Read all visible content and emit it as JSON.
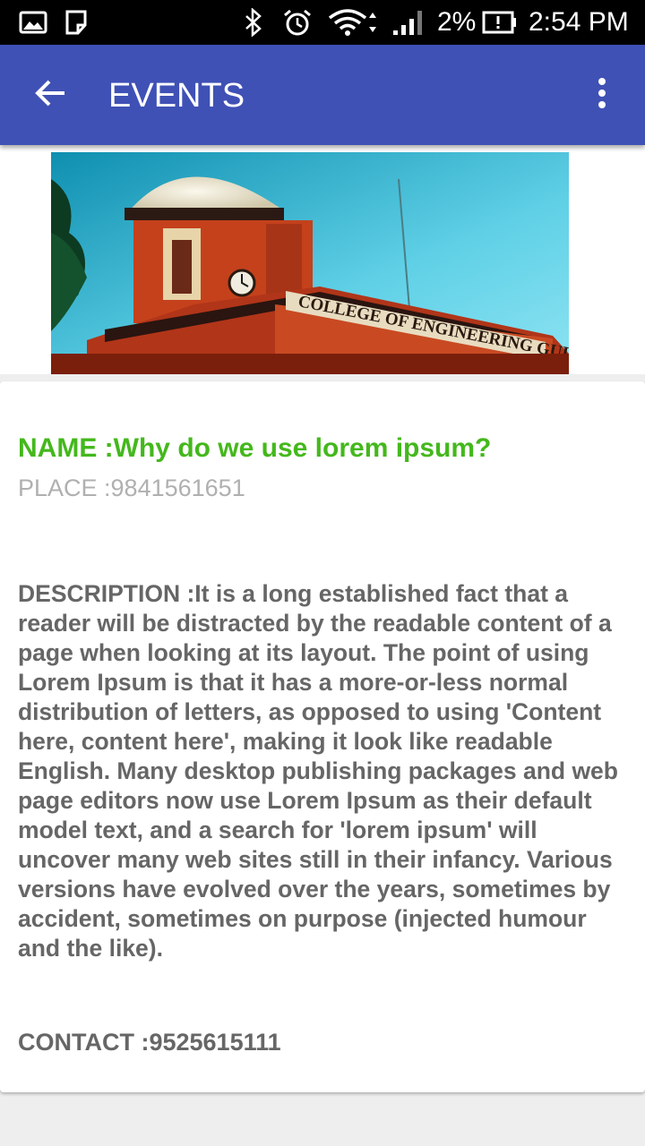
{
  "status_bar": {
    "battery_percent": "2%",
    "time": "2:54 PM",
    "icons": [
      "gallery-icon",
      "sim-icon",
      "bluetooth-icon",
      "alarm-icon",
      "wifi-icon",
      "signal-icon",
      "battery-alert-icon"
    ]
  },
  "app_bar": {
    "title": "EVENTS",
    "background": "#3f51b5"
  },
  "event": {
    "banner_text": "COLLEGE OF ENGINEERING GUINDY",
    "name": "NAME :Why do we use lorem ipsum?",
    "place": "PLACE :9841561651",
    "description": "DESCRIPTION :It is a long established fact that a reader will be distracted by the readable content of a page when looking at its layout. The point of using Lorem Ipsum is that it has a more-or-less normal distribution of letters, as opposed to using 'Content here, content here', making it look like readable English. Many desktop publishing packages and web page editors now use Lorem Ipsum as their default model text, and a search for 'lorem ipsum' will uncover many web sites still in their infancy. Various versions have evolved over the years, sometimes by accident, sometimes on purpose (injected humour and the like).",
    "contact": "CONTACT :9525615111",
    "name_color": "#44b81c"
  }
}
